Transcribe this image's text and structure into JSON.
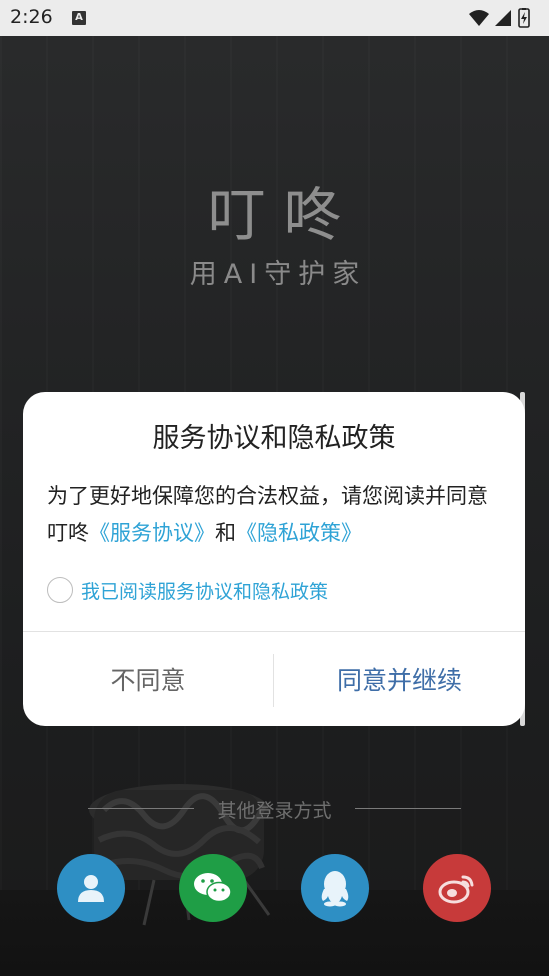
{
  "status_bar": {
    "time": "2:26",
    "notification_icon": "a-icon",
    "icons": [
      "wifi-icon",
      "signal-icon",
      "battery-icon"
    ]
  },
  "brand": {
    "title": "叮咚",
    "slogan": "用AI守护家"
  },
  "dialog": {
    "title": "服务协议和隐私政策",
    "body_prefix": "为了更好地保障您的合法权益，请您阅读并同意叮咚",
    "service_link": "《服务协议》",
    "conjunction": "和",
    "privacy_link": "《隐私政策》",
    "agree_checkbox_label": "我已阅读服务协议和隐私政策",
    "disagree_button": "不同意",
    "agree_button": "同意并继续"
  },
  "other_login": {
    "label": "其他登录方式",
    "methods": [
      {
        "icon": "user-icon",
        "color": "#2e8fc4"
      },
      {
        "icon": "wechat-icon",
        "color": "#1f9e46"
      },
      {
        "icon": "qq-icon",
        "color": "#2e8fc4"
      },
      {
        "icon": "weibo-icon",
        "color": "#c73a3a"
      }
    ]
  },
  "colors": {
    "link": "#2fa3d6",
    "agree_button": "#3f6ea8"
  }
}
